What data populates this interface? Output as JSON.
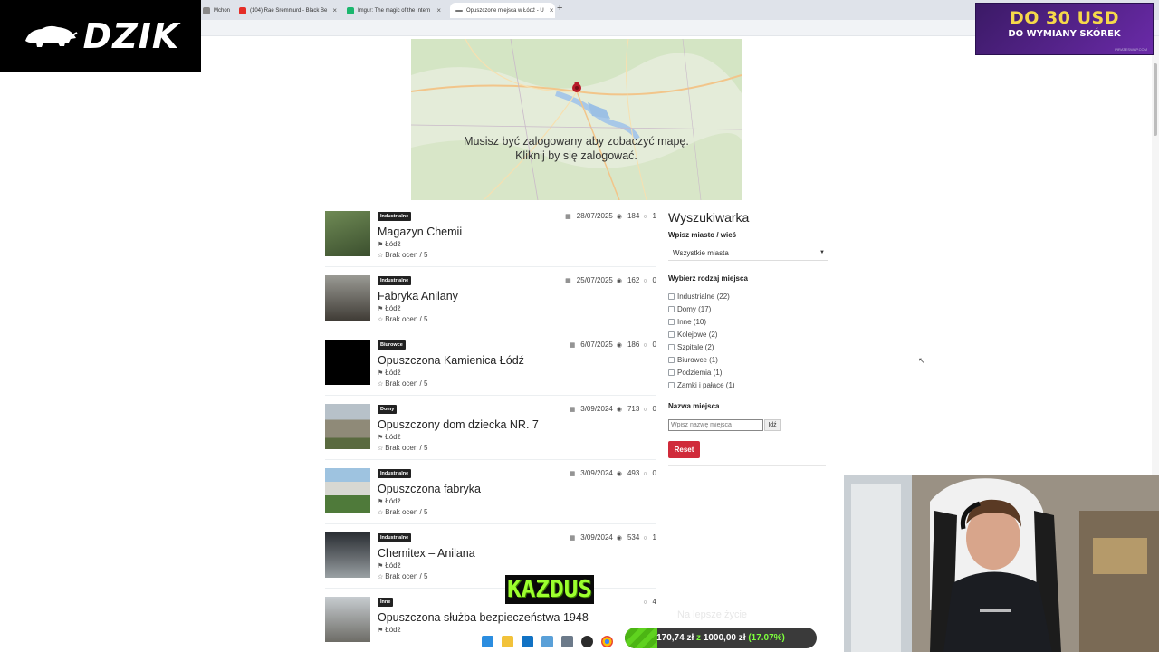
{
  "browser": {
    "tabs": [
      {
        "label": "Mchon",
        "color": "#888888"
      },
      {
        "label": "(104) Rae Sremmurd - Black Be",
        "color": "#e52d27"
      },
      {
        "label": "Imgur: The magic of the Intern",
        "color": "#1bb76e"
      },
      {
        "label": "Opuszczone miejsca w Łódź - U",
        "color": "#777777",
        "active": true
      }
    ],
    "close_glyph": "×",
    "new_tab_glyph": "+"
  },
  "overlay": {
    "logo_text": "DZIK",
    "ad": {
      "line1": "DO 30 USD",
      "line2": "DO WYMIANY SKÓREK",
      "footer": "PIRATESWAP.COM"
    },
    "brand_name": "KAZDUS",
    "faded_text": "Na lepsze życie",
    "donation": {
      "current": "170,74 zł",
      "sep": "z",
      "goal": "1000,00 zł",
      "percent": "(17.07%)",
      "fraction": 0.1707
    }
  },
  "map": {
    "message_line1": "Musisz być zalogowany aby zobaczyć mapę.",
    "message_line2": "Kliknij by się zalogować."
  },
  "listings": [
    {
      "category": "Industrialne",
      "title": "Magazyn Chemii",
      "city": "Łódź",
      "rating": "Brak ocen / 5",
      "date": "28/07/2025",
      "views": "184",
      "comments": "1",
      "thumb": "#4f6a3a"
    },
    {
      "category": "Industrialne",
      "title": "Fabryka Anilany",
      "city": "Łódź",
      "rating": "Brak ocen / 5",
      "date": "25/07/2025",
      "views": "162",
      "comments": "0",
      "thumb": "#5b5a55"
    },
    {
      "category": "Biurowce",
      "title": "Opuszczona Kamienica Łódź",
      "city": "Łódź",
      "rating": "Brak ocen / 5",
      "date": "6/07/2025",
      "views": "186",
      "comments": "0",
      "thumb": "#000000"
    },
    {
      "category": "Domy",
      "title": "Opuszczony dom dziecka NR. 7",
      "city": "Łódź",
      "rating": "Brak ocen / 5",
      "date": "3/09/2024",
      "views": "713",
      "comments": "0",
      "thumb": "#7b7a66"
    },
    {
      "category": "Industrialne",
      "title": "Opuszczona fabryka",
      "city": "Łódź",
      "rating": "Brak ocen / 5",
      "date": "3/09/2024",
      "views": "493",
      "comments": "0",
      "thumb": "#5e7d4a"
    },
    {
      "category": "Industrialne",
      "title": "Chemitex – Anilana",
      "city": "Łódź",
      "rating": "Brak ocen / 5",
      "date": "3/09/2024",
      "views": "534",
      "comments": "1",
      "thumb": "#3a3f45"
    },
    {
      "category": "Inne",
      "title": "Opuszczona służba bezpieczeństwa 1948",
      "city": "Łódź",
      "rating": "",
      "date": "",
      "views": "",
      "comments": "4",
      "thumb": "#6d6c66"
    }
  ],
  "search": {
    "heading": "Wyszukiwarka",
    "city_label": "Wpisz miasto / wieś",
    "city_selected": "Wszystkie miasta",
    "type_label": "Wybierz rodzaj miejsca",
    "types": [
      "Industrialne (22)",
      "Domy (17)",
      "Inne (10)",
      "Kolejowe (2)",
      "Szpitale (2)",
      "Biurowce (1)",
      "Podziemia (1)",
      "Zamki i pałace (1)"
    ],
    "name_label": "Nazwa miejsca",
    "name_placeholder": "Wpisz nazwę miejsca",
    "go_label": "Idź",
    "reset_label": "Reset"
  }
}
